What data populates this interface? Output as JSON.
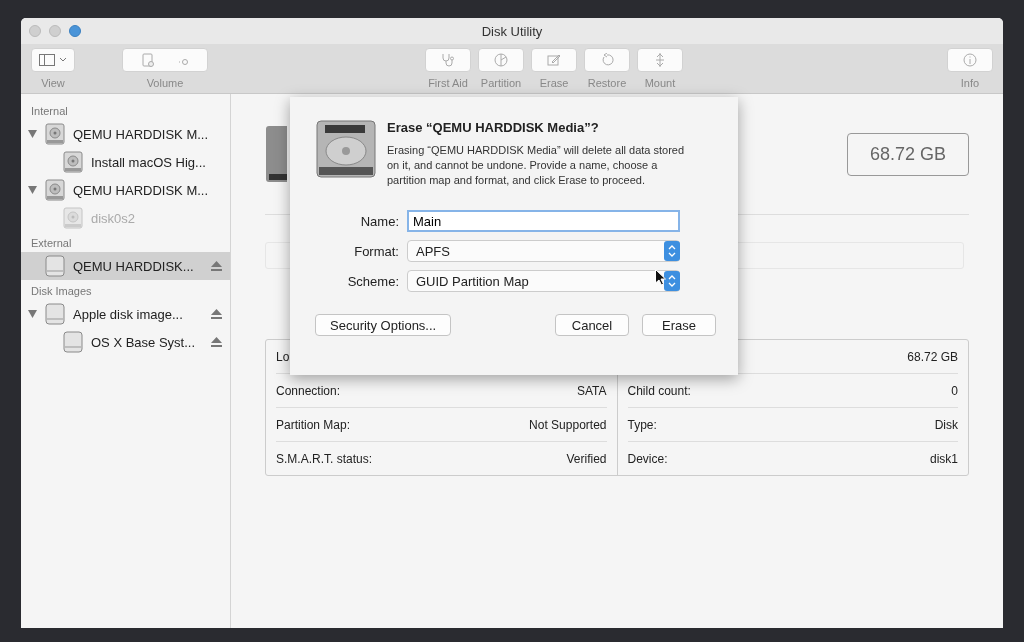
{
  "window": {
    "title": "Disk Utility"
  },
  "toolbar": [
    {
      "kind": "view",
      "label": "View"
    },
    {
      "kind": "volume",
      "label": "Volume"
    },
    {
      "kind": "firstaid",
      "label": "First Aid"
    },
    {
      "kind": "partition",
      "label": "Partition"
    },
    {
      "kind": "erase",
      "label": "Erase"
    },
    {
      "kind": "restore",
      "label": "Restore"
    },
    {
      "kind": "mount",
      "label": "Mount"
    },
    {
      "kind": "info",
      "label": "Info"
    }
  ],
  "sidebar": {
    "sections": [
      {
        "title": "Internal",
        "items": [
          {
            "label": "QEMU HARDDISK M...",
            "kind": "internal",
            "expanded": true,
            "selected": false,
            "disabled": false,
            "eject": false,
            "children": [
              {
                "label": "Install macOS Hig...",
                "kind": "internal",
                "selected": false,
                "disabled": false,
                "eject": false
              }
            ]
          },
          {
            "label": "QEMU HARDDISK M...",
            "kind": "internal",
            "expanded": true,
            "selected": false,
            "disabled": false,
            "eject": false,
            "children": [
              {
                "label": "disk0s2",
                "kind": "internal",
                "selected": false,
                "disabled": true,
                "eject": false
              }
            ]
          }
        ]
      },
      {
        "title": "External",
        "items": [
          {
            "label": "QEMU HARDDISK...",
            "kind": "external",
            "selected": true,
            "disabled": false,
            "eject": true
          }
        ]
      },
      {
        "title": "Disk Images",
        "items": [
          {
            "label": "Apple disk image...",
            "kind": "external",
            "expanded": true,
            "selected": false,
            "disabled": false,
            "eject": true,
            "children": [
              {
                "label": "OS X Base Syst...",
                "kind": "external",
                "selected": false,
                "disabled": false,
                "eject": true
              }
            ]
          }
        ]
      }
    ]
  },
  "header": {
    "capacity": "68.72 GB"
  },
  "info": {
    "left": [
      {
        "label": "Lo"
      },
      {
        "label": "Connection:",
        "value": "SATA"
      },
      {
        "label": "Partition Map:",
        "value": "Not Supported"
      },
      {
        "label": "S.M.A.R.T. status:",
        "value": "Verified"
      }
    ],
    "right": [
      {
        "value": "68.72 GB"
      },
      {
        "label": "Child count:",
        "value": "0"
      },
      {
        "label": "Type:",
        "value": "Disk"
      },
      {
        "label": "Device:",
        "value": "disk1"
      }
    ]
  },
  "dialog": {
    "title": "Erase “QEMU HARDDISK Media”?",
    "message": "Erasing “QEMU HARDDISK Media” will delete all data stored on it, and cannot be undone. Provide a name, choose a partition map and format, and click Erase to proceed.",
    "fields": [
      {
        "kind": "text",
        "label": "Name:",
        "value": "Main"
      },
      {
        "kind": "popup",
        "label": "Format:",
        "value": "APFS"
      },
      {
        "kind": "popup",
        "label": "Scheme:",
        "value": "GUID Partition Map"
      }
    ],
    "buttons": [
      {
        "kind": "left",
        "label": "Security Options..."
      },
      {
        "kind": "right",
        "label": "Cancel"
      },
      {
        "kind": "right",
        "label": "Erase"
      }
    ]
  }
}
